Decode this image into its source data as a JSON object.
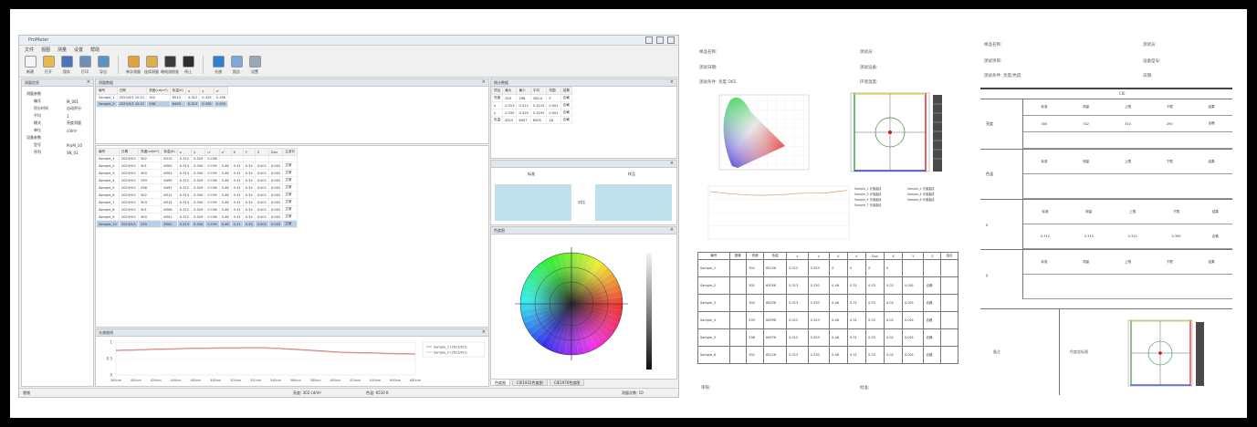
{
  "app": {
    "title": "ProMeter",
    "menu": [
      "文件",
      "视图",
      "测量",
      "设置",
      "帮助"
    ],
    "toolbar": [
      {
        "label": "新建",
        "icon": "new-file-icon",
        "color": "#f5f5f5"
      },
      {
        "label": "打开",
        "icon": "open-folder-icon",
        "color": "#e8b84a"
      },
      {
        "label": "保存",
        "icon": "save-icon",
        "color": "#4a74b8"
      },
      {
        "label": "打印",
        "icon": "print-icon",
        "color": "#6f8fb8"
      },
      {
        "label": "导出",
        "icon": "export-icon",
        "color": "#5b93c9"
      },
      {
        "label": "单次测量",
        "icon": "single-measure-icon",
        "color": "#e4a23b"
      },
      {
        "label": "连续测量",
        "icon": "continuous-measure-icon",
        "color": "#d9b04a"
      },
      {
        "label": "暗电流校准",
        "icon": "dark-calibration-icon",
        "color": "#3b3b3b"
      },
      {
        "label": "停止",
        "icon": "stop-icon",
        "color": "#2e2e2e"
      },
      {
        "label": "光谱",
        "icon": "spectrum-icon",
        "color": "#2f7fd6"
      },
      {
        "label": "报告",
        "icon": "report-icon",
        "color": "#7fa7d9"
      },
      {
        "label": "设置",
        "icon": "settings-icon",
        "color": "#9aa7b5"
      }
    ],
    "left_panel": {
      "title": "测量信息",
      "rows": [
        [
          "测量参数",
          ""
        ],
        [
          "编号",
          "M_001"
        ],
        [
          "积分时间",
          "自动积分"
        ],
        [
          "平均",
          "1"
        ],
        [
          "模式",
          "亮度测量"
        ],
        [
          "单位",
          "cd/m²"
        ],
        [
          "设备参数",
          ""
        ],
        [
          "型号",
          "ProM_10"
        ],
        [
          "序列",
          "SN_01"
        ]
      ]
    },
    "top_table": {
      "title": "测量数据",
      "headers": [
        "编号",
        "日期",
        "亮度(cd/m²)",
        "色温(K)",
        "x",
        "y",
        "u'"
      ],
      "rows": [
        [
          "Sample_1",
          "2023/9/1 10:21",
          "302",
          "6510",
          "0.312",
          "0.329",
          "0.198"
        ],
        [
          "Sample_2",
          "2023/9/1 10:22",
          "298",
          "6498",
          "0.313",
          "0.330",
          "0.199"
        ]
      ]
    },
    "main_table": {
      "headers": [
        "编号",
        "日期",
        "亮度(cd/m²)",
        "色温(K)",
        "x",
        "y",
        "u'",
        "v'",
        "X",
        "Y",
        "Z",
        "Duv",
        "主波长"
      ],
      "rows": [
        [
          "Sample_1",
          "2023/9/1",
          "302",
          "6510",
          "0.312",
          "0.329",
          "0.198",
          "",
          "",
          "",
          "",
          "",
          ""
        ],
        [
          "Sample_2",
          "2023/9/1",
          "301",
          "6505",
          "0.313",
          "0.330",
          "0.199",
          "0.46",
          "0.31",
          "0.33",
          "0.001",
          "0.002",
          "正常"
        ],
        [
          "Sample_3",
          "2023/9/1",
          "300",
          "6503",
          "0.313",
          "0.330",
          "0.199",
          "0.46",
          "0.31",
          "0.33",
          "0.001",
          "0.002",
          "正常"
        ],
        [
          "Sample_4",
          "2023/9/1",
          "299",
          "6499",
          "0.312",
          "0.329",
          "0.198",
          "0.46",
          "0.31",
          "0.33",
          "0.001",
          "0.002",
          "正常"
        ],
        [
          "Sample_5",
          "2023/9/1",
          "298",
          "6497",
          "0.312",
          "0.329",
          "0.198",
          "0.46",
          "0.31",
          "0.33",
          "0.001",
          "0.002",
          "正常"
        ],
        [
          "Sample_6",
          "2023/9/1",
          "302",
          "6512",
          "0.313",
          "0.330",
          "0.199",
          "0.46",
          "0.31",
          "0.33",
          "0.001",
          "0.002",
          "正常"
        ],
        [
          "Sample_7",
          "2023/9/1",
          "303",
          "6515",
          "0.313",
          "0.330",
          "0.199",
          "0.46",
          "0.31",
          "0.33",
          "0.001",
          "0.002",
          "正常"
        ],
        [
          "Sample_8",
          "2023/9/1",
          "301",
          "6506",
          "0.312",
          "0.329",
          "0.198",
          "0.46",
          "0.31",
          "0.33",
          "0.001",
          "0.002",
          "正常"
        ],
        [
          "Sample_9",
          "2023/9/1",
          "300",
          "6501",
          "0.312",
          "0.329",
          "0.198",
          "0.46",
          "0.31",
          "0.33",
          "0.001",
          "0.002",
          "正常"
        ],
        [
          "Sample_10",
          "2023/9/1",
          "299",
          "6500",
          "0.313",
          "0.330",
          "0.199",
          "0.46",
          "0.31",
          "0.33",
          "0.001",
          "0.002",
          "正常"
        ]
      ]
    },
    "spectrum_panel": {
      "title": "光谱曲线",
      "legend": [
        "Sample_1 (2023/9/1)",
        "Sample_2 (2023/9/1)"
      ],
      "x_ticks": [
        "380nm",
        "400nm",
        "420nm",
        "440nm",
        "460nm",
        "480nm",
        "500nm",
        "520nm",
        "540nm",
        "560nm",
        "580nm",
        "600nm",
        "620nm",
        "640nm",
        "660nm",
        "680nm"
      ],
      "y_ticks": [
        "1",
        "0.5",
        "0"
      ]
    },
    "right_table": {
      "title": "统计数据",
      "headers": [
        "项目",
        "最大",
        "最小",
        "平均",
        "范围",
        "结果"
      ],
      "rows": [
        [
          "亮度",
          "303",
          "298",
          "300.4",
          "5",
          "合格"
        ],
        [
          "x",
          "0.313",
          "0.312",
          "0.3125",
          "0.001",
          "合格"
        ],
        [
          "y",
          "0.330",
          "0.329",
          "0.3295",
          "0.001",
          "合格"
        ],
        [
          "色温",
          "6515",
          "6497",
          "6505",
          "18",
          "合格"
        ]
      ]
    },
    "color_panel": {
      "left_label": "标准",
      "right_label": "样品",
      "middle_label": "对比",
      "color": "#bfe0ec"
    },
    "wheel_panel": {
      "title": "色度图"
    },
    "bottom_tabs": [
      "色度图",
      "CIE1931色度图",
      "CIE1976色度图"
    ],
    "status": [
      "就绪",
      "亮度: 302 cd/m²",
      "色温: 6510 K",
      "测量次数: 10"
    ]
  },
  "report1": {
    "header_left": [
      "样品名称:",
      "测试日期:",
      "测试条件: 亮度 D65"
    ],
    "header_right": [
      "测试员:",
      "测试设备:",
      "环境温度:"
    ],
    "legend": [
      "Sample_1 光谱曲线",
      "Sample_2 光谱曲线",
      "Sample_3 光谱曲线",
      "Sample_4 光谱曲线",
      "Sample_5 光谱曲线",
      "Sample_6 光谱曲线",
      "Sample_7 光谱曲线"
    ],
    "table_headers": [
      "编号",
      "图像",
      "亮度",
      "色温",
      "x",
      "y",
      "u'",
      "v'",
      "Duv",
      "X",
      "Y",
      "Z",
      "结论"
    ],
    "table_rows": [
      [
        "Sample_1",
        "",
        "302",
        "6510K",
        "0.312",
        "0.329",
        "0",
        "0",
        "0",
        "0",
        "",
        "",
        ""
      ],
      [
        "Sample_2",
        "",
        "301",
        "6505K",
        "0.313",
        "0.330",
        "0.46",
        "0.31",
        "0.33",
        "0.02",
        "0.001",
        "合格",
        ""
      ],
      [
        "Sample_3",
        "",
        "300",
        "6503K",
        "0.313",
        "0.330",
        "0.46",
        "0.31",
        "0.33",
        "0.02",
        "0.001",
        "合格",
        ""
      ],
      [
        "Sample_4",
        "",
        "299",
        "6499K",
        "0.312",
        "0.329",
        "0.46",
        "0.31",
        "0.33",
        "0.02",
        "0.001",
        "合格",
        ""
      ],
      [
        "Sample_5",
        "",
        "298",
        "6497K",
        "0.312",
        "0.329",
        "0.46",
        "0.31",
        "0.33",
        "0.02",
        "0.001",
        "合格",
        ""
      ],
      [
        "Sample_6",
        "",
        "302",
        "6512K",
        "0.313",
        "0.330",
        "0.46",
        "0.31",
        "0.33",
        "0.02",
        "0.001",
        "合格",
        ""
      ]
    ],
    "footer_left": "审核:",
    "footer_right": "批准:"
  },
  "report2": {
    "header_left": [
      "样品名称:",
      "测试项目:",
      "测试条件: 亮度/色度"
    ],
    "header_right": [
      "测试员:",
      "设备型号:",
      "日期:"
    ],
    "top_label": "CIE",
    "sections": [
      {
        "name": "亮度",
        "rows": [
          [
            "标准",
            "测量",
            "上限",
            "下限",
            "结果"
          ],
          [
            "300",
            "302",
            "310",
            "290",
            "合格"
          ],
          [
            "",
            "",
            "",
            "",
            ""
          ]
        ]
      },
      {
        "name": "色温",
        "rows": [
          [
            "标准",
            "测量",
            "上限",
            "下限",
            "结果"
          ],
          [
            "",
            "",
            "",
            "",
            ""
          ]
        ]
      },
      {
        "name": "x",
        "rows": [
          [
            "标准",
            "测量",
            "上限",
            "下限",
            "结果"
          ],
          [
            "0.312",
            "0.313",
            "0.315",
            "0.309",
            "合格"
          ]
        ]
      },
      {
        "name": "y",
        "rows": [
          [
            "标准",
            "测量",
            "上限",
            "下限",
            "结果"
          ],
          [
            "",
            "",
            "",
            "",
            ""
          ]
        ]
      }
    ],
    "bottom_left": "备注",
    "bottom_mid": "色度坐标图"
  }
}
